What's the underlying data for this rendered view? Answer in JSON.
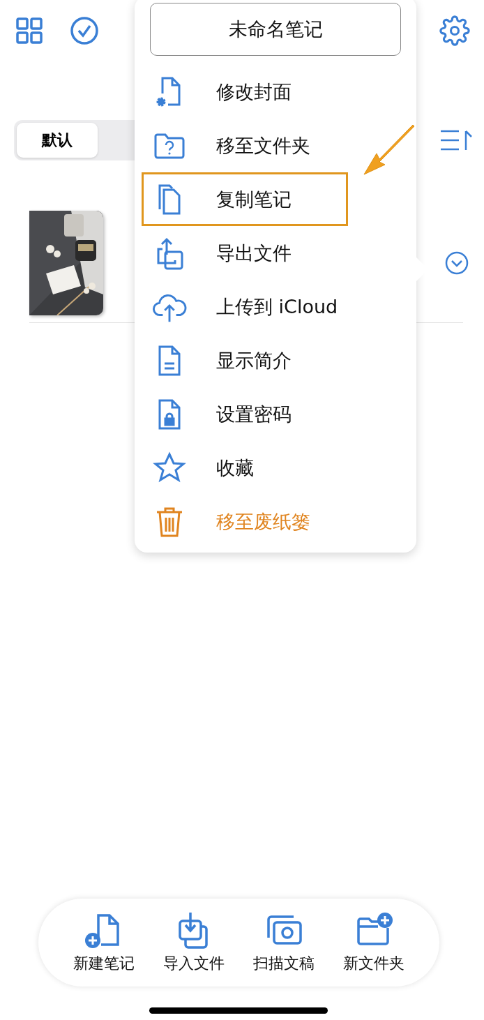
{
  "segments": [
    {
      "label": "默认",
      "selected": true
    }
  ],
  "note_title": "未命名笔记",
  "menu": [
    {
      "label": "修改封面",
      "kind": "normal",
      "highlighted": false
    },
    {
      "label": "移至文件夹",
      "kind": "normal",
      "highlighted": false
    },
    {
      "label": "复制笔记",
      "kind": "normal",
      "highlighted": true
    },
    {
      "label": "导出文件",
      "kind": "normal",
      "highlighted": false
    },
    {
      "label": "上传到 iCloud",
      "kind": "normal",
      "highlighted": false
    },
    {
      "label": "显示简介",
      "kind": "normal",
      "highlighted": false
    },
    {
      "label": "设置密码",
      "kind": "normal",
      "highlighted": false
    },
    {
      "label": "收藏",
      "kind": "normal",
      "highlighted": false
    },
    {
      "label": "移至废纸篓",
      "kind": "destructive",
      "highlighted": false
    }
  ],
  "toolbar": [
    "新建笔记",
    "导入文件",
    "扫描文稿",
    "新文件夹"
  ]
}
